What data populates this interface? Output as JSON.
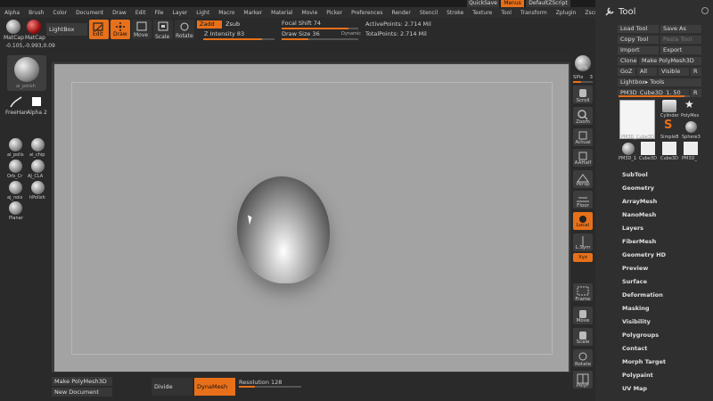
{
  "menubar": {
    "items": [
      "Alpha",
      "Brush",
      "Color",
      "Document",
      "Draw",
      "Edit",
      "File",
      "Layer",
      "Light",
      "Macro",
      "Marker",
      "Material",
      "Movie",
      "Picker",
      "Preferences",
      "Render",
      "Stencil",
      "Stroke",
      "Texture",
      "Tool",
      "Transform",
      "Zplugin",
      "Zscript"
    ],
    "quicksave": "QuickSave",
    "menus": "Menus",
    "default_zscript": "DefaultZScript"
  },
  "shelf": {
    "matcap1": "MatCap",
    "matcap2": "MatCap",
    "lightbox": "LightBox",
    "edit": "Edit",
    "draw": "Draw",
    "move": "Move",
    "scale": "Scale",
    "rotate": "Rotate",
    "zadd": "Zadd",
    "zsub": "Zsub",
    "focal_shift": "Focal Shift 74",
    "z_intensity": "Z Intensity 83",
    "draw_size": "Draw Size 36",
    "dynamic": "Dynamic",
    "active_points": "ActivePoints: 2.714 Mil",
    "total_points": "TotalPoints: 2.714 Mil",
    "coords": "-0.105,-0.993,0.09"
  },
  "left": {
    "brush_label": "ai_polish",
    "freehand": "FreeHan",
    "alpha": "Alpha",
    "alpha_num": "2",
    "brushes": [
      "ai_polis",
      "ai_chip",
      "Orb_Cr",
      "AJ_CLA",
      "aj_nois",
      "hPolish",
      "Planar"
    ]
  },
  "right": {
    "items": [
      "BPR",
      "SPix",
      "Scroll",
      "Zoom",
      "Actual",
      "AAHalf",
      "Persp",
      "Floor",
      "Local",
      "L.Sym",
      "Xyz",
      "Frame",
      "Move",
      "Scale",
      "Rotate",
      "PolyF"
    ],
    "spix_val": "3"
  },
  "bottom": {
    "make_polymesh": "Make PolyMesh3D",
    "new_document": "New Document",
    "divide": "Divide",
    "dynamesh": "DynaMesh",
    "resolution": "Resolution 128"
  },
  "toolpanel": {
    "title": "Tool",
    "load_tool": "Load Tool",
    "save_as": "Save As",
    "copy_tool": "Copy Tool",
    "paste_tool": "Paste Tool",
    "import": "Import",
    "export": "Export",
    "clone": "Clone",
    "make_polymesh": "Make PolyMesh3D",
    "goz": "GoZ",
    "all": "All",
    "visible": "Visible",
    "r": "R",
    "lightbox_tools": "Lightbox▸ Tools",
    "current_tool": "PM3D_Cube3D_1. 50",
    "r2": "R",
    "thumbs": [
      "PM3D_Cube3D",
      "Cylinder",
      "PolyMes",
      "SimpleB",
      "Sphere3",
      "PM3D_1",
      "Cube3D",
      "Cube3D",
      "PM3D_"
    ],
    "subpalettes": [
      "SubTool",
      "Geometry",
      "ArrayMesh",
      "NanoMesh",
      "Layers",
      "FiberMesh",
      "Geometry HD",
      "Preview",
      "Surface",
      "Deformation",
      "Masking",
      "Visibility",
      "Polygroups",
      "Contact",
      "Morph Target",
      "Polypaint",
      "UV Map"
    ]
  },
  "colors": {
    "accent": "#e8701a",
    "canvas": "#a3a3a3",
    "panel": "#2f2f2f"
  }
}
